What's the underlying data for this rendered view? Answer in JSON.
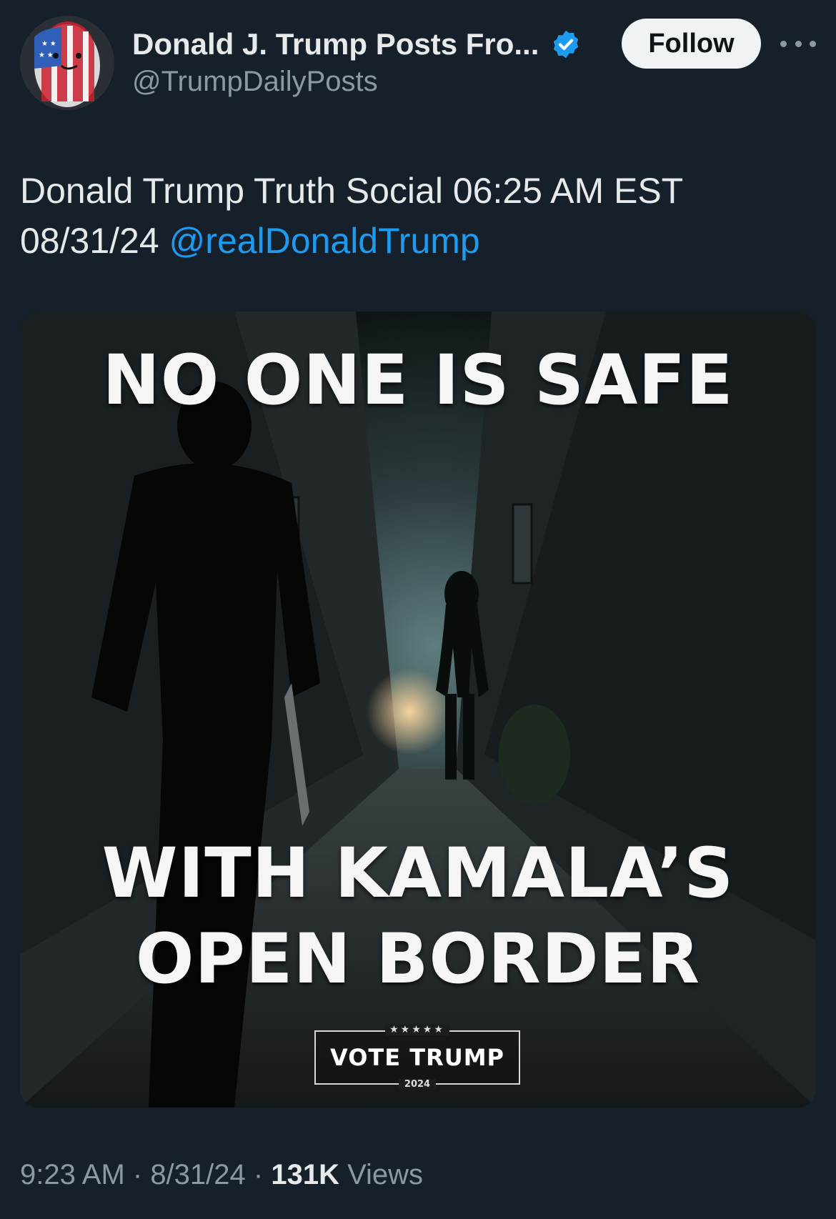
{
  "header": {
    "display_name": "Donald J. Trump Posts Fro...",
    "handle": "@TrumpDailyPosts",
    "follow_label": "Follow"
  },
  "tweet": {
    "text_line1": "Donald Trump Truth Social 06:25 AM EST",
    "text_line2_prefix": "08/31/24 ",
    "mention": "@realDonaldTrump"
  },
  "media": {
    "headline": "NO ONE IS SAFE",
    "sub_line1": "WITH KAMALA’S",
    "sub_line2": "OPEN BORDER",
    "badge_stars": "★★★★★",
    "badge_text": "VOTE TRUMP",
    "badge_year": "2024"
  },
  "footer": {
    "time": "9:23 AM",
    "sep1": " · ",
    "date": "8/31/24",
    "sep2": " · ",
    "views_count": "131K",
    "views_label": " Views"
  },
  "colors": {
    "background": "#15202b",
    "accent": "#1d9bf0",
    "secondary_text": "#8b98a5"
  },
  "icons": [
    "verified-badge-icon",
    "more-options-icon",
    "avatar-image"
  ]
}
